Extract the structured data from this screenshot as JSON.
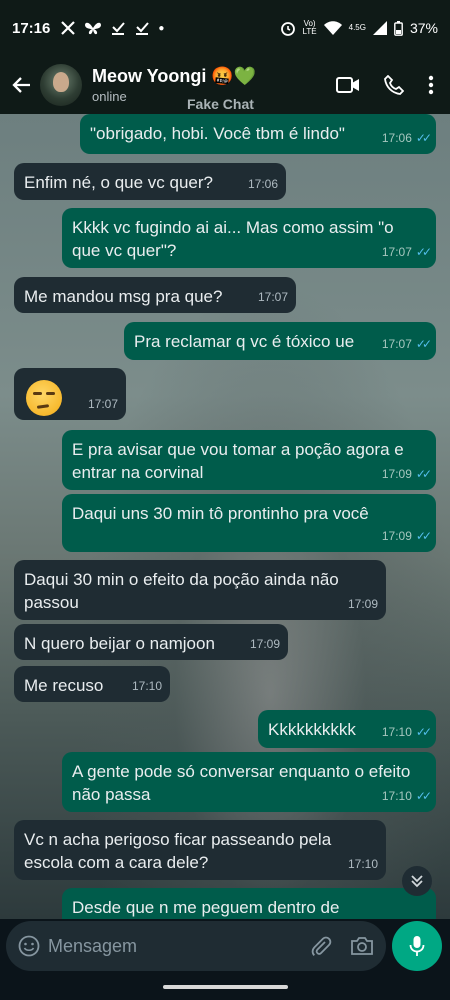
{
  "status_bar": {
    "time": "17:16",
    "network_label_top": "Vo)",
    "network_label_bottom": "LTE",
    "signal_label": "4.5G",
    "battery": "37%"
  },
  "header": {
    "name": "Meow Yoongi 🤬💚",
    "presence": "online",
    "watermark": "Fake Chat"
  },
  "messages": [
    {
      "dir": "out",
      "text": "\"obrigado, hobi. Você tbm é lindo\"",
      "time": "17:06"
    },
    {
      "dir": "in",
      "text": "Enfim né, o que vc quer?",
      "time": "17:06"
    },
    {
      "dir": "out",
      "text": "Kkkk vc fugindo ai ai... Mas como assim \"o que vc quer\"?",
      "time": "17:07"
    },
    {
      "dir": "in",
      "text": "Me mandou msg pra que?",
      "time": "17:07"
    },
    {
      "dir": "out",
      "text": "Pra reclamar q vc é tóxico ue",
      "time": "17:07"
    },
    {
      "dir": "in",
      "text": "😒",
      "time": "17:07"
    },
    {
      "dir": "out",
      "text": "E pra avisar que vou tomar a poção agora e entrar na corvinal",
      "time": "17:09"
    },
    {
      "dir": "out",
      "text": "Daqui uns 30 min tô prontinho pra você",
      "time": "17:09"
    },
    {
      "dir": "in",
      "text": "Daqui 30 min o efeito da poção ainda não passou",
      "time": "17:09"
    },
    {
      "dir": "in",
      "text": "N quero beijar o namjoon",
      "time": "17:09"
    },
    {
      "dir": "in",
      "text": "Me recuso",
      "time": "17:10"
    },
    {
      "dir": "out",
      "text": "Kkkkkkkkkk",
      "time": "17:10"
    },
    {
      "dir": "out",
      "text": "A gente pode só conversar enquanto o efeito não passa",
      "time": "17:10"
    },
    {
      "dir": "in",
      "text": "Vc n acha perigoso ficar passeando pela escola com a cara dele?",
      "time": "17:10"
    },
    {
      "dir": "out",
      "text": "Desde que n me peguem dentro de",
      "time": ""
    }
  ],
  "input": {
    "placeholder": "Mensagem"
  },
  "colors": {
    "incoming_bubble": "#1f2c33",
    "outgoing_bubble": "#005c4b",
    "accent": "#00a884",
    "read_ticks": "#53bdeb"
  },
  "icons": [
    "back-arrow-icon",
    "video-call-icon",
    "phone-icon",
    "more-vertical-icon",
    "emoji-icon",
    "attach-icon",
    "camera-icon",
    "mic-icon",
    "chevron-double-down-icon"
  ]
}
